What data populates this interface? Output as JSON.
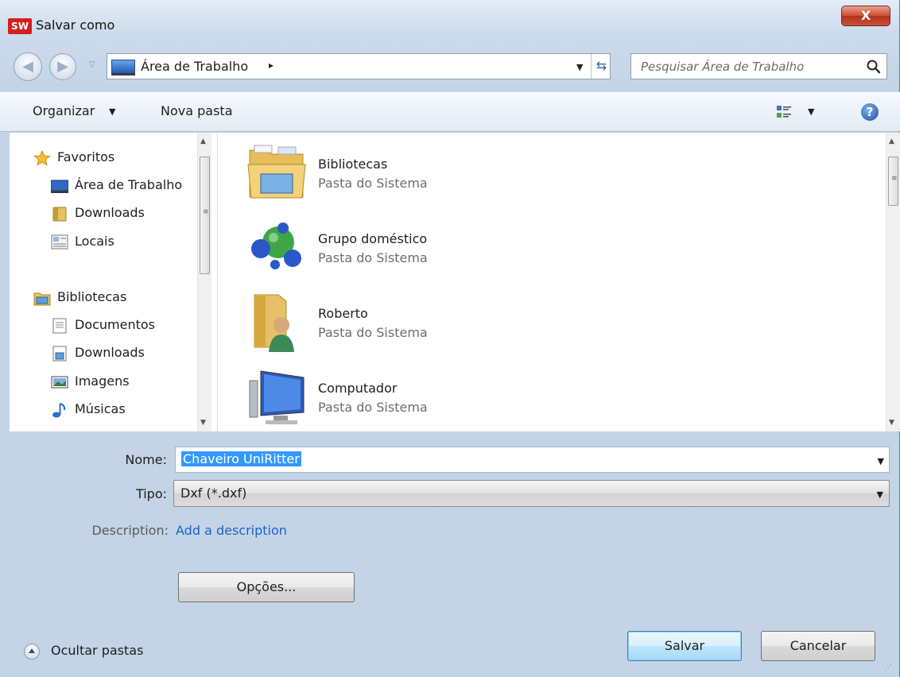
{
  "window": {
    "title": "Salvar como",
    "app_icon_text": "SW",
    "close_label": "X"
  },
  "navbar": {
    "address_location": "Área de Trabalho",
    "address_separator": "▸",
    "search_placeholder": "Pesquisar Área de Trabalho"
  },
  "toolbar": {
    "organize_label": "Organizar",
    "new_folder_label": "Nova pasta",
    "help_label": "?"
  },
  "sidebar": {
    "favorites": {
      "label": "Favoritos",
      "items": [
        {
          "label": "Área de Trabalho",
          "icon": "desktop-icon"
        },
        {
          "label": "Downloads",
          "icon": "downloads-folder-icon"
        },
        {
          "label": "Locais",
          "icon": "recent-places-icon"
        }
      ]
    },
    "libraries": {
      "label": "Bibliotecas",
      "items": [
        {
          "label": "Documentos",
          "icon": "documents-icon"
        },
        {
          "label": "Downloads",
          "icon": "downloads-library-icon"
        },
        {
          "label": "Imagens",
          "icon": "pictures-icon"
        },
        {
          "label": "Músicas",
          "icon": "music-icon"
        }
      ]
    }
  },
  "files": [
    {
      "name": "Bibliotecas",
      "type": "Pasta do Sistema",
      "icon": "libraries-folder-icon"
    },
    {
      "name": "Grupo doméstico",
      "type": "Pasta do Sistema",
      "icon": "homegroup-icon"
    },
    {
      "name": "Roberto",
      "type": "Pasta do Sistema",
      "icon": "user-folder-icon"
    },
    {
      "name": "Computador",
      "type": "Pasta do Sistema",
      "icon": "computer-icon"
    }
  ],
  "form": {
    "name_label": "Nome:",
    "name_value": "Chaveiro UniRitter",
    "type_label": "Tipo:",
    "type_value": "Dxf (*.dxf)",
    "description_label": "Description:",
    "description_link": "Add a description",
    "options_button": "Opções...",
    "save_button": "Salvar",
    "cancel_button": "Cancelar",
    "hide_folders_label": "Ocultar pastas"
  },
  "colors": {
    "accent_link": "#1a63c7",
    "selection": "#3399ff",
    "close_button": "#c9513a"
  }
}
